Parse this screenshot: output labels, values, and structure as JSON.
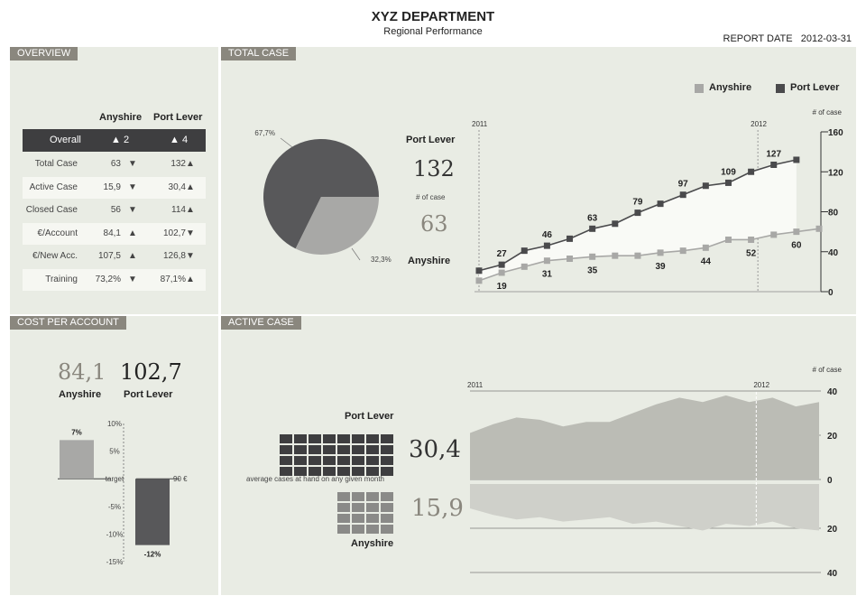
{
  "header": {
    "title": "XYZ DEPARTMENT",
    "subtitle": "Regional Performance",
    "report_date_label": "REPORT DATE",
    "report_date": "2012-03-31"
  },
  "overview": {
    "title": "OVERVIEW",
    "col1": "Anyshire",
    "col2": "Port Lever",
    "overall_label": "Overall",
    "overall_a": "▲ 2",
    "overall_b": "▲ 4",
    "rows": [
      {
        "label": "Total Case",
        "a": "63",
        "a_arrow": "▼",
        "b": "132",
        "b_arrow": "▲"
      },
      {
        "label": "Active Case",
        "a": "15,9",
        "a_arrow": "▼",
        "b": "30,4",
        "b_arrow": "▲"
      },
      {
        "label": "Closed Case",
        "a": "56",
        "a_arrow": "▼",
        "b": "114",
        "b_arrow": "▲"
      },
      {
        "label": "€/Account",
        "a": "84,1",
        "a_arrow": "▲",
        "b": "102,7",
        "b_arrow": "▼"
      },
      {
        "label": "€/New Acc.",
        "a": "107,5",
        "a_arrow": "▲",
        "b": "126,8",
        "b_arrow": "▼"
      },
      {
        "label": "Training",
        "a": "73,2%",
        "a_arrow": "▼",
        "b": "87,1%",
        "b_arrow": "▲"
      }
    ]
  },
  "total_case": {
    "title": "TOTAL CASE",
    "legend_a": "Anyshire",
    "legend_b": "Port Lever",
    "port_lever_label": "Port Lever",
    "port_lever_value": "132",
    "num_case_label": "# of case",
    "anyshire_value": "63",
    "anyshire_label": "Anyshire"
  },
  "cost": {
    "title": "COST PER ACCOUNT",
    "anyshire_value": "84,1",
    "anyshire_label": "Anyshire",
    "port_value": "102,7",
    "port_label": "Port Lever"
  },
  "active_case": {
    "title": "ACTIVE CASE",
    "port_label": "Port Lever",
    "port_value": "30,4",
    "caption": "average cases at hand on any given month",
    "anyshire_value": "15,9",
    "anyshire_label": "Anyshire",
    "port_squares": 32,
    "anyshire_squares": 16
  },
  "colors": {
    "dark": "#58585a",
    "light": "#a8a8a6",
    "panel": "#e9ece4",
    "title_bg": "#8a877e"
  },
  "chart_data": [
    {
      "type": "pie",
      "slices": [
        {
          "label": "67,7%",
          "value": 67.7
        },
        {
          "label": "32,3%",
          "value": 32.3
        }
      ]
    },
    {
      "type": "line",
      "ylabel": "# of case",
      "ylim": [
        0,
        160
      ],
      "yticks": [
        "0",
        "40",
        "80",
        "120",
        "160"
      ],
      "year_markers": [
        "2011",
        "2012"
      ],
      "series": [
        {
          "name": "Port Lever",
          "values": [
            21,
            27,
            41,
            46,
            53,
            63,
            68,
            79,
            88,
            97,
            106,
            109,
            120,
            127,
            132
          ],
          "labels": {
            "1": "27",
            "3": "46",
            "5": "63",
            "7": "79",
            "9": "97",
            "11": "109",
            "13": "127"
          }
        },
        {
          "name": "Anyshire",
          "values": [
            11,
            19,
            25,
            31,
            33,
            35,
            36,
            36,
            39,
            41,
            44,
            52,
            52,
            57,
            60,
            63
          ],
          "labels": {
            "1": "19",
            "3": "31",
            "5": "35",
            "8": "39",
            "10": "44",
            "12": "52",
            "14": "60"
          }
        }
      ]
    },
    {
      "type": "bar",
      "categories": [
        "Anyshire",
        "Port Lever"
      ],
      "values": [
        7,
        -12
      ],
      "value_labels": [
        "7%",
        "-12%"
      ],
      "yticks": [
        "10%",
        "5%",
        "target",
        "-5%",
        "-10%",
        "-15%"
      ],
      "ylim": [
        -15,
        10
      ],
      "annotation": "90 €"
    },
    {
      "type": "area",
      "ylabel": "# of case",
      "yticks_upper": [
        "40",
        "20",
        "0"
      ],
      "yticks_lower": [
        "20",
        "40"
      ],
      "year_markers": [
        "2011",
        "2012"
      ],
      "series": [
        {
          "name": "Port Lever",
          "values": [
            21,
            25,
            28,
            27,
            24,
            26,
            26,
            30,
            34,
            37,
            35,
            38,
            35,
            37,
            33,
            35
          ]
        },
        {
          "name": "Anyshire",
          "values": [
            11,
            14,
            16,
            15,
            17,
            16,
            15,
            18,
            17,
            19,
            21,
            18,
            19,
            17,
            20,
            21
          ]
        }
      ]
    }
  ]
}
